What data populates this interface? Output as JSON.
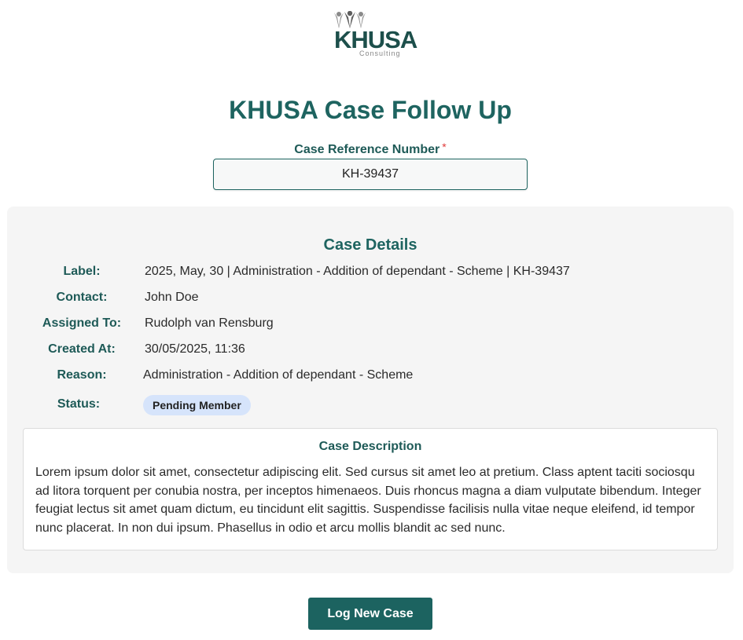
{
  "logo": {
    "word": "KHUSA",
    "sub": "Consulting"
  },
  "page_title": "KHUSA Case Follow Up",
  "reference": {
    "label": "Case Reference Number",
    "required_mark": "*",
    "value": "KH-39437"
  },
  "details": {
    "title": "Case Details",
    "rows": [
      {
        "label": "Label:",
        "value": "2025, May, 30 | Administration - Addition of dependant - Scheme | KH-39437"
      },
      {
        "label": "Contact:",
        "value": "John Doe"
      },
      {
        "label": "Assigned To:",
        "value": "Rudolph van Rensburg"
      },
      {
        "label": "Created At:",
        "value": "30/05/2025, 11:36"
      },
      {
        "label": "Reason:",
        "value": "Administration - Addition of dependant - Scheme"
      },
      {
        "label": "Status:",
        "value": "Pending Member"
      }
    ]
  },
  "description": {
    "title": "Case Description",
    "text": "Lorem ipsum dolor sit amet, consectetur adipiscing elit. Sed cursus sit amet leo at pretium. Class aptent taciti sociosqu ad litora torquent per conubia nostra, per inceptos himenaeos. Duis rhoncus magna a diam vulputate bibendum. Integer feugiat lectus sit amet quam dictum, eu tincidunt elit sagittis. Suspendisse facilisis nulla vitae neque eleifend, id tempor nunc placerat. In non dui ipsum. Phasellus in odio et arcu mollis blandit ac sed nunc."
  },
  "actions": {
    "log_new_case_label": "Log New Case"
  },
  "colors": {
    "brand_teal": "#1e6460",
    "button": "#1c6360",
    "status_badge_bg": "#d6e4fb",
    "required": "#e03a3a"
  },
  "icons": {
    "logo_figures": "people-icon"
  }
}
